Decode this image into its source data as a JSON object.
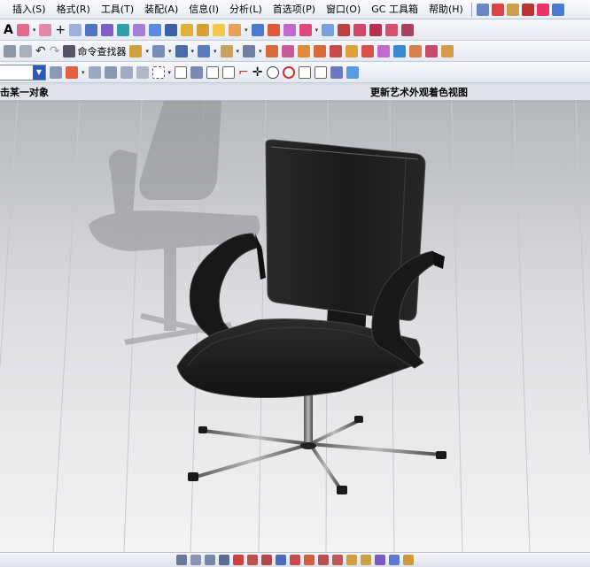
{
  "menu": {
    "items": [
      "插入(S)",
      "格式(R)",
      "工具(T)",
      "装配(A)",
      "信息(I)",
      "分析(L)",
      "首选项(P)",
      "窗口(O)",
      "GC 工具箱",
      "帮助(H)"
    ]
  },
  "toolbar2": {
    "command_finder_label": "命令查找器"
  },
  "status": {
    "left_prompt": "击某一对象",
    "right_prompt": "更新艺术外观着色视图"
  },
  "colors": {
    "viewport_top": "#b4b7bb",
    "viewport_bottom": "#f4f4f5",
    "chair_body": "#1b1b1b",
    "selection_blue": "#2c5ab8"
  }
}
